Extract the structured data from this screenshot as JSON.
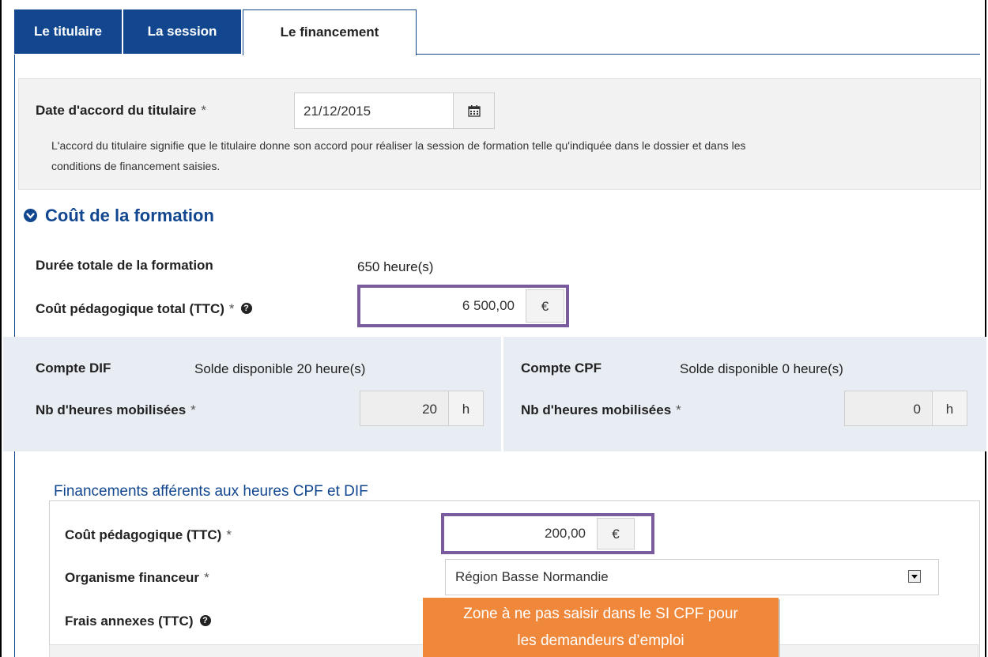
{
  "tabs": [
    {
      "label": "Le titulaire"
    },
    {
      "label": "La session"
    },
    {
      "label": "Le financement"
    }
  ],
  "accord": {
    "label": "Date d'accord du titulaire",
    "required_mark": "*",
    "date_value": "21/12/2015",
    "icon": "calendar-icon",
    "help_line1": "L'accord du titulaire signifie que le titulaire donne son accord pour réaliser la session de formation telle qu'indiquée dans le dossier et dans les",
    "help_line2": "conditions de financement saisies."
  },
  "cout_section": {
    "title": "Coût de la formation",
    "icon": "chevron-down-circle-icon",
    "duree_label": "Durée totale de la formation",
    "duree_value": "650 heure(s)",
    "cout_label": "Coût pédagogique total (TTC)",
    "required_mark": "*",
    "help_icon": "question-circle-icon",
    "cout_value": "6 500,00",
    "currency": "€"
  },
  "comptes": {
    "dif": {
      "label": "Compte DIF",
      "solde": "Solde disponible 20 heure(s)",
      "nb_label": "Nb d'heures mobilisées",
      "required_mark": "*",
      "value": "20",
      "unit": "h"
    },
    "cpf": {
      "label": "Compte CPF",
      "solde": "Solde disponible 0 heure(s)",
      "nb_label": "Nb d'heures mobilisées",
      "required_mark": "*",
      "value": "0",
      "unit": "h"
    }
  },
  "financements": {
    "title": "Financements afférents aux heures CPF et DIF",
    "cout_label": "Coût pédagogique (TTC)",
    "required_mark": "*",
    "cout_value": "200,00",
    "currency": "€",
    "organisme_label": "Organisme financeur",
    "organisme_value": "Région Basse Normandie",
    "frais_label": "Frais annexes (TTC)",
    "help_icon": "question-circle-icon"
  },
  "callout": {
    "line1": "Zone à ne pas saisir dans le SI CPF pour",
    "line2": "les demandeurs d’emploi"
  },
  "colors": {
    "brand_blue": "#12478f",
    "highlight_purple": "#7a5c9e",
    "callout_orange": "#f0883b"
  }
}
